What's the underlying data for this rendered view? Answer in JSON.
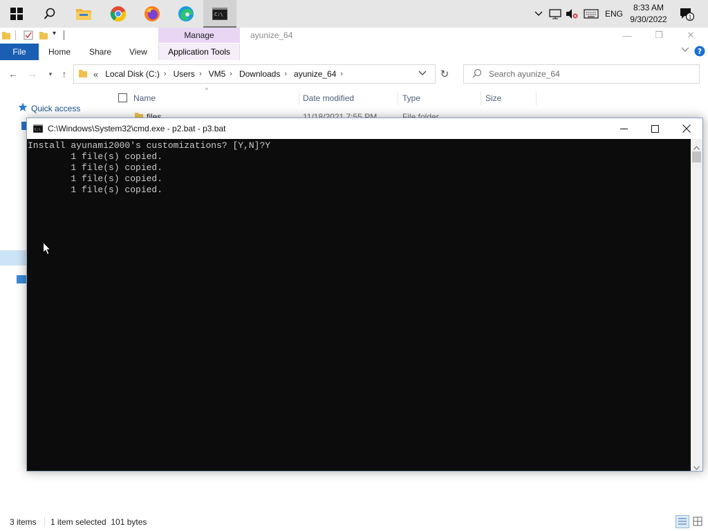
{
  "taskbar": {
    "icons": [
      "windows-start-icon",
      "search-icon",
      "file-explorer-icon",
      "chrome-icon",
      "firefox-icon",
      "edge-icon",
      "cmd-icon"
    ],
    "tray": {
      "language": "ENG",
      "time": "8:33 AM",
      "date": "9/30/2022",
      "notification_count": "1"
    }
  },
  "explorer": {
    "title": "ayunize_64",
    "context_tab": "Manage",
    "ribbon_tabs": {
      "file": "File",
      "home": "Home",
      "share": "Share",
      "view": "View",
      "app_tools": "Application Tools"
    },
    "breadcrumb": {
      "overflow": "«",
      "items": [
        "Local Disk (C:)",
        "Users",
        "VM5",
        "Downloads",
        "ayunize_64"
      ]
    },
    "search_placeholder": "Search ayunize_64",
    "columns": {
      "name": "Name",
      "date": "Date modified",
      "type": "Type",
      "size": "Size"
    },
    "first_row": {
      "name": "files",
      "date": "11/18/2021 7:55 PM",
      "type": "File folder"
    },
    "nav": {
      "quick_access": "Quick access"
    },
    "status": {
      "items": "3 items",
      "selected": "1 item selected  101 bytes"
    }
  },
  "cmd": {
    "title": "C:\\Windows\\System32\\cmd.exe - p2.bat - p3.bat",
    "lines": [
      "Install ayunami2000's customizations? [Y,N]?Y",
      "        1 file(s) copied.",
      "        1 file(s) copied.",
      "        1 file(s) copied.",
      "        1 file(s) copied."
    ]
  },
  "colors": {
    "accent": "#1a5fb4",
    "manage_tab": "#e9d6f4",
    "console_bg": "#0c0c0c",
    "console_text": "#cccccc",
    "taskbar": "#e6e6e6"
  }
}
